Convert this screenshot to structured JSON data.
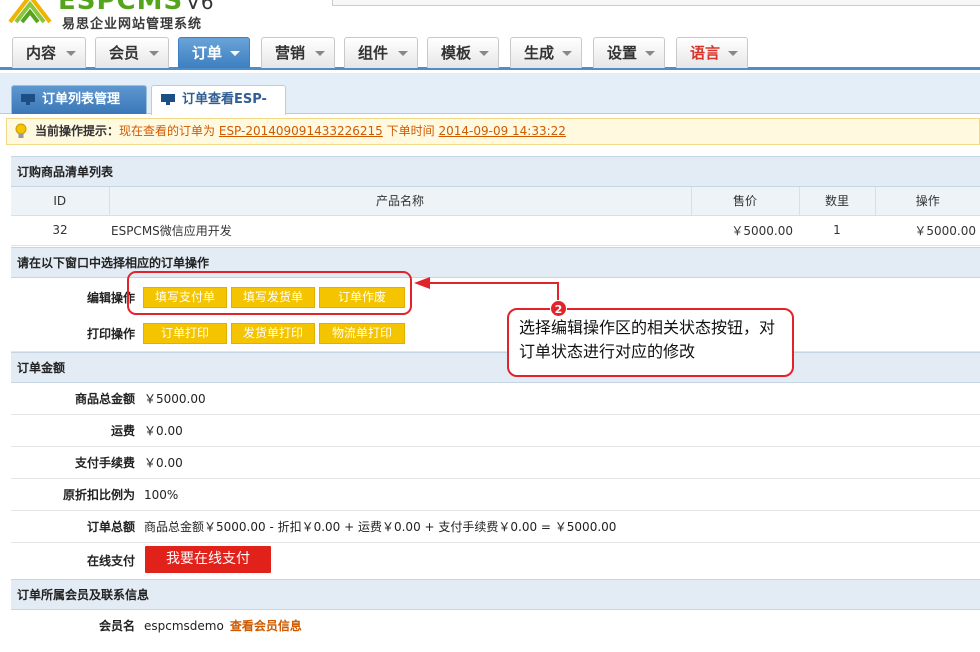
{
  "brand": {
    "name": "ESPCMS",
    "version": "V6",
    "subtitle": "易思企业网站管理系统"
  },
  "nav": {
    "tabs": [
      {
        "label": "内容"
      },
      {
        "label": "会员"
      },
      {
        "label": "订单"
      },
      {
        "label": "营销"
      },
      {
        "label": "组件"
      },
      {
        "label": "模板"
      },
      {
        "label": "生成"
      },
      {
        "label": "设置"
      },
      {
        "label": "语言"
      }
    ],
    "active_index": 2
  },
  "subtabs": {
    "manage": "订单列表管理",
    "view": "订单查看ESP-"
  },
  "tip": {
    "lead": "当前操作提示：",
    "text1": "现在查看的订单为",
    "order_no": "ESP-201409091433226215",
    "text2": "下单时间",
    "order_time": "2014-09-09 14:33:22"
  },
  "products": {
    "title": "订购商品清单列表",
    "columns": [
      "ID",
      "产品名称",
      "售价",
      "数里",
      "操作"
    ],
    "rows": [
      {
        "id": "32",
        "name": "ESPCMS微信应用开发",
        "price": "￥5000.00",
        "qty": "1",
        "total": "￥5000.00"
      }
    ]
  },
  "operations": {
    "title": "请在以下窗口中选择相应的订单操作",
    "edit_label": "编辑操作",
    "edit_buttons": [
      "填写支付单",
      "填写发货单",
      "订单作废"
    ],
    "print_label": "打印操作",
    "print_buttons": [
      "订单打印",
      "发货单打印",
      "物流单打印"
    ]
  },
  "amount": {
    "title": "订单金额",
    "rows": [
      {
        "label": "商品总金额",
        "value": "￥5000.00"
      },
      {
        "label": "运费",
        "value": "￥0.00"
      },
      {
        "label": "支付手续费",
        "value": "￥0.00"
      },
      {
        "label": "原折扣比例为",
        "value": "100%"
      },
      {
        "label": "订单总额",
        "value": "商品总金额￥5000.00 - 折扣￥0.00 + 运费￥0.00 + 支付手续费￥0.00 = ￥5000.00"
      }
    ],
    "pay_label": "在线支付",
    "pay_button": "我要在线支付"
  },
  "member": {
    "title": "订单所属会员及联系信息",
    "name_label": "会员名",
    "name_value": "espcmsdemo",
    "link": "查看会员信息"
  },
  "annotation": {
    "badge": "2",
    "text": "选择编辑操作区的相关状态按钮，对订单状态进行对应的修改"
  },
  "colors": {
    "accent": "#4d8ec9",
    "yellow_button": "#f5c400",
    "pay_red": "#e0221b",
    "annotation_red": "#e2232a",
    "link_orange": "#d05a00"
  }
}
